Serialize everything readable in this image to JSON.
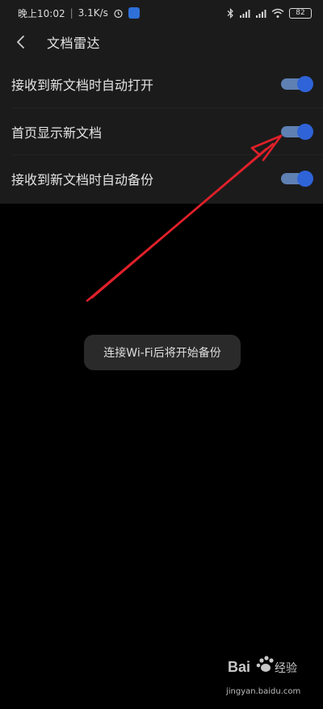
{
  "status_bar": {
    "time": "晚上10:02",
    "network_speed": "3.1K/s",
    "battery_level": "82",
    "icons": [
      "alarm-icon",
      "app-notification-icon",
      "bluetooth-icon",
      "signal-hd-icon",
      "signal-hd-icon",
      "wifi-icon",
      "battery-icon"
    ]
  },
  "header": {
    "title": "文档雷达",
    "back_icon": "chevron-left-icon"
  },
  "settings": [
    {
      "label": "接收到新文档时自动打开",
      "toggle_on": true
    },
    {
      "label": "首页显示新文档",
      "toggle_on": true
    },
    {
      "label": "接收到新文档时自动备份",
      "toggle_on": true
    }
  ],
  "toast": {
    "message": "连接Wi-Fi后将开始备份"
  },
  "annotation": {
    "arrow_color": "#e0202a"
  },
  "colors": {
    "toggle_thumb": "#2f63d8",
    "toggle_track": "#5f80b3",
    "panel_bg": "#1b1b1b"
  },
  "watermark": {
    "logo_text": "Bai 经验",
    "url": "jingyan.baidu.com"
  }
}
